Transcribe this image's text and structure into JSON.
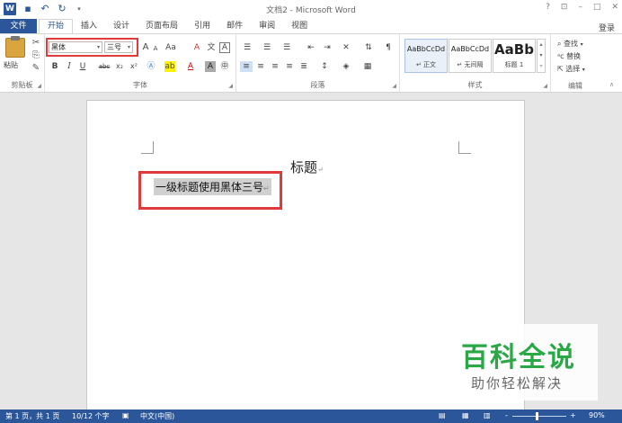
{
  "titlebar": {
    "title": "文档2 - Microsoft Word",
    "app_icon": "W",
    "controls": [
      "?",
      "⊡",
      "–",
      "□",
      "✕"
    ]
  },
  "tabs": {
    "file": "文件",
    "items": [
      "开始",
      "插入",
      "设计",
      "页面布局",
      "引用",
      "邮件",
      "审阅",
      "视图"
    ],
    "login": "登录"
  },
  "ribbon": {
    "clipboard": {
      "paste": "粘贴",
      "label": "剪贴板"
    },
    "font": {
      "font_name": "黑体",
      "font_size": "三号",
      "label": "字体",
      "grow": "A",
      "shrink": "A",
      "case": "Aa",
      "bold": "B",
      "italic": "I",
      "underline": "U",
      "strike": "abc",
      "subscript": "x₂",
      "superscript": "x²",
      "font_color": "A",
      "char_shade": "A",
      "char_border": "A",
      "enclose": "㊥",
      "phonetic": "文",
      "clear": "A"
    },
    "paragraph": {
      "label": "段落"
    },
    "styles": {
      "label": "样式",
      "items": [
        {
          "sample": "AaBbCcDd",
          "name": "↵ 正文"
        },
        {
          "sample": "AaBbCcDd",
          "name": "↵ 无间隔"
        },
        {
          "sample": "AaBb",
          "name": "标题 1"
        }
      ]
    },
    "editing": {
      "label": "编辑",
      "find": "查找",
      "replace": "替换",
      "select": "选择"
    }
  },
  "document": {
    "title_text": "标题",
    "heading_text": "一级标题使用黑体三号",
    "para_mark": "↵"
  },
  "watermark": {
    "main": "百科全说",
    "sub": "助你轻松解决"
  },
  "statusbar": {
    "page": "第 1 页，共 1 页",
    "words": "10/12 个字",
    "language": "中文(中国)",
    "zoom": "90%",
    "zoom_minus": "-",
    "zoom_plus": "+"
  }
}
